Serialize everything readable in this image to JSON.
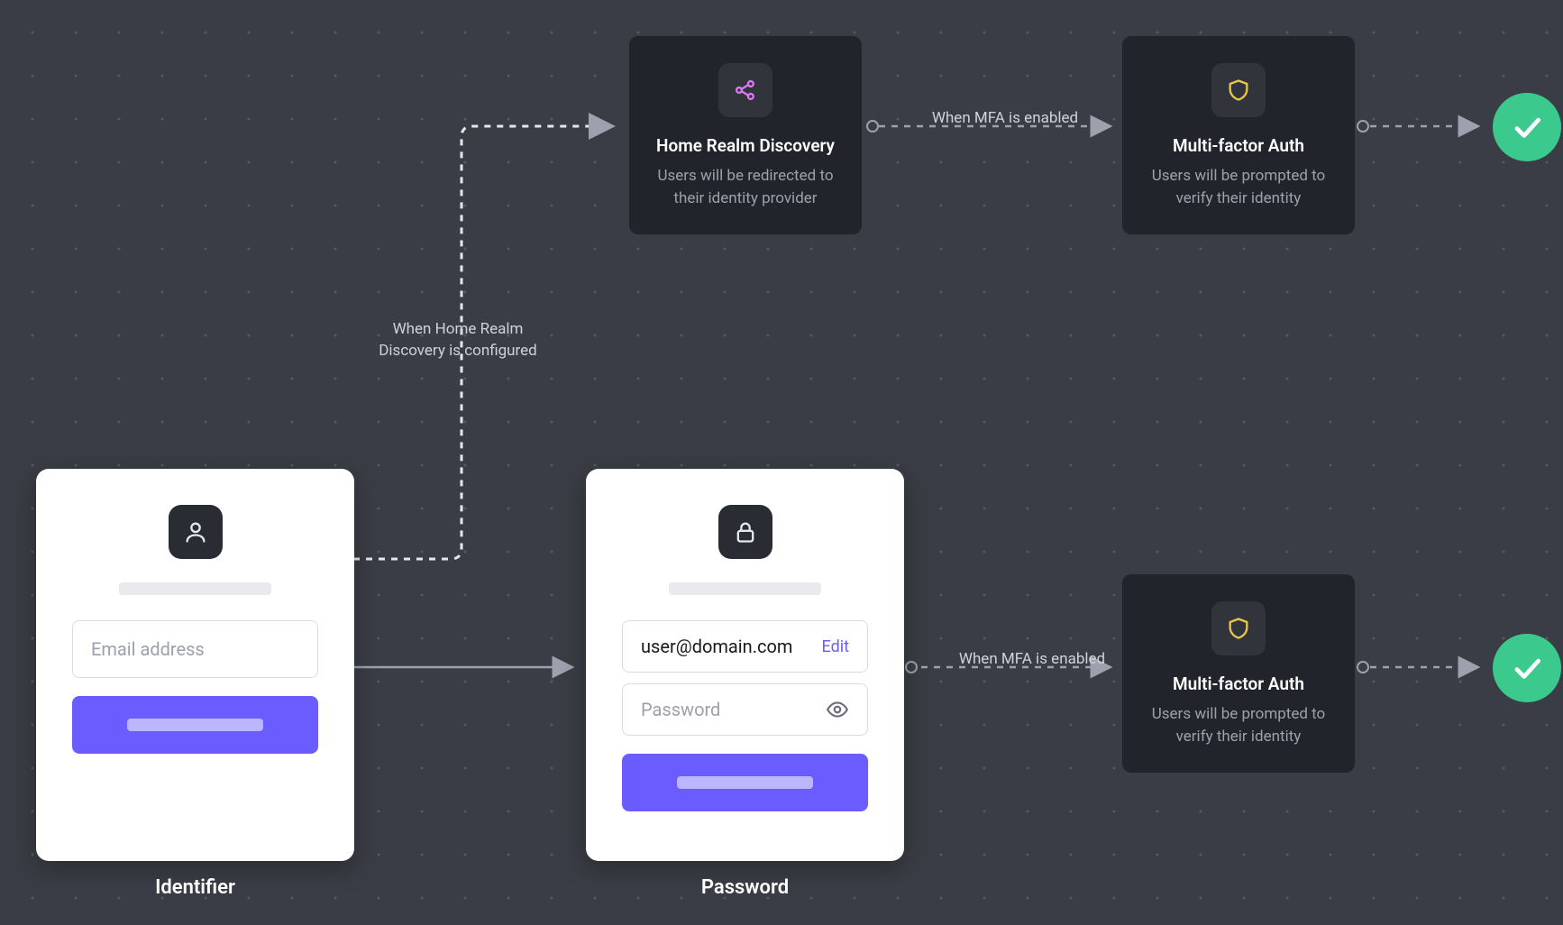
{
  "cards": {
    "identifier": {
      "label": "Identifier",
      "email_placeholder": "Email address"
    },
    "password": {
      "label": "Password",
      "user_value": "user@domain.com",
      "edit_link": "Edit",
      "password_placeholder": "Password"
    },
    "hrd": {
      "title": "Home Realm Discovery",
      "desc": "Users will be redirected to their identity provider"
    },
    "mfa_top": {
      "title": "Multi-factor Auth",
      "desc": "Users will be prompted to verify their identity"
    },
    "mfa_bottom": {
      "title": "Multi-factor Auth",
      "desc": "Users will be prompted to verify their identity"
    }
  },
  "edges": {
    "hrd_condition": "When Home Realm Discovery is configured",
    "mfa_top": "When MFA is enabled",
    "mfa_bottom": "When MFA is enabled"
  }
}
